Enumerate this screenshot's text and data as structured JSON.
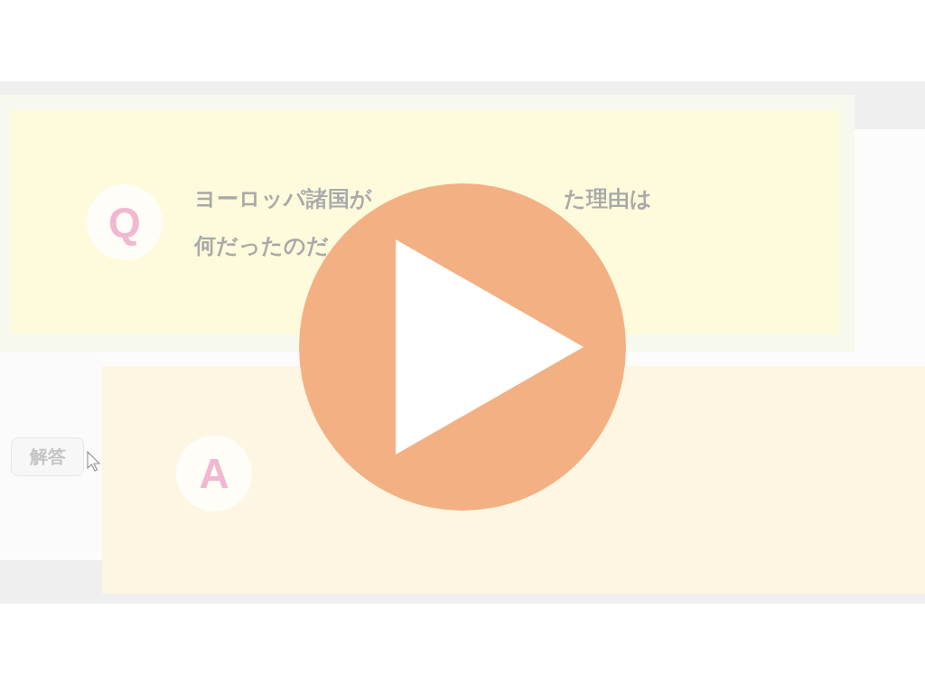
{
  "question": {
    "mark": "Q",
    "lines": [
      [
        "ヨーロッパ諸国が",
        "た理由は"
      ],
      [
        "何だったのだ"
      ]
    ]
  },
  "answer": {
    "mark": "A"
  },
  "answer_button": {
    "label": "解答"
  },
  "player": {
    "play_button": true
  }
}
